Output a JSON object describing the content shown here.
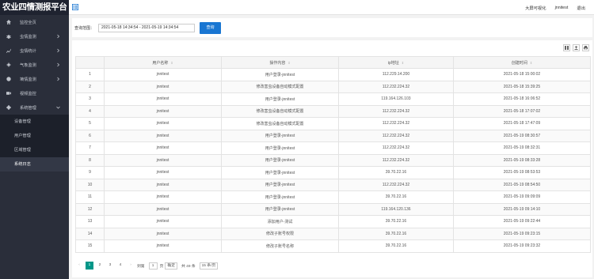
{
  "app": {
    "title": "农业四情测报平台"
  },
  "sidebar": {
    "items": [
      {
        "label": "监控全页",
        "icon": "home-icon",
        "expandable": false
      },
      {
        "label": "虫情监测",
        "icon": "bug-icon",
        "expandable": true
      },
      {
        "label": "虫情统计",
        "icon": "chart-line-icon",
        "expandable": true
      },
      {
        "label": "气象监测",
        "icon": "weather-icon",
        "expandable": true
      },
      {
        "label": "墒情监测",
        "icon": "globe-icon",
        "expandable": true
      },
      {
        "label": "视频监控",
        "icon": "video-icon",
        "expandable": false
      },
      {
        "label": "系统管理",
        "icon": "gear-icon",
        "expandable": true,
        "expanded": true
      }
    ],
    "sub_items": [
      {
        "label": "设备管理",
        "active": false
      },
      {
        "label": "用户管理",
        "active": false
      },
      {
        "label": "区域管理",
        "active": false
      },
      {
        "label": "系统日志",
        "active": true
      }
    ]
  },
  "topbar": {
    "links": [
      "大屏可视化",
      "jnnitest",
      "退出"
    ]
  },
  "search": {
    "label": "查询范围：",
    "value": "2021-05-18 14:34:54 - 2021-05-19 14:34:54",
    "button": "查询"
  },
  "table": {
    "headers": [
      "",
      "用户名称",
      "操作内容",
      "ip地址",
      "创建时间"
    ],
    "rows": [
      [
        "1",
        "jnnitest",
        "用户登录-jnnitest",
        "112.229.14.200",
        "2021-05-18 15:00:02"
      ],
      [
        "2",
        "jnnitest",
        "修改害虫设备自动模式配置",
        "112.232.224.32",
        "2021-05-18 15:39:25"
      ],
      [
        "3",
        "jnnitest",
        "用户登录-jnnitest",
        "119.164.126.103",
        "2021-05-18 16:06:52"
      ],
      [
        "4",
        "jnnitest",
        "修改害虫设备自动模式配置",
        "112.232.224.32",
        "2021-05-18 17:07:02"
      ],
      [
        "5",
        "jnnitest",
        "修改害虫设备自动模式配置",
        "112.232.224.32",
        "2021-05-18 17:47:09"
      ],
      [
        "6",
        "jnnitest",
        "用户登录-jnnitest",
        "112.232.224.32",
        "2021-05-19 08:30:57"
      ],
      [
        "7",
        "jnnitest",
        "用户登录-jnnitest",
        "112.232.224.32",
        "2021-05-19 08:32:31"
      ],
      [
        "8",
        "jnnitest",
        "用户登录-jnnitest",
        "112.232.224.32",
        "2021-05-19 08:33:28"
      ],
      [
        "9",
        "jnnitest",
        "用户登录-jnnitest",
        "39.70.22.16",
        "2021-05-19 08:53:53"
      ],
      [
        "10",
        "jnnitest",
        "用户登录-jnnitest",
        "112.232.224.32",
        "2021-05-19 08:54:50"
      ],
      [
        "11",
        "jnnitest",
        "用户登录-jnnitest",
        "39.70.22.16",
        "2021-05-19 09:09:09"
      ],
      [
        "12",
        "jnnitest",
        "用户登录-jnnitest",
        "119.164.120.136",
        "2021-05-19 09:14:10"
      ],
      [
        "13",
        "jnnitest",
        "添加用户-测试",
        "39.70.22.16",
        "2021-05-19 09:22:44"
      ],
      [
        "14",
        "jnnitest",
        "修改子账号权限",
        "39.70.22.16",
        "2021-05-19 09:23:15"
      ],
      [
        "15",
        "jnnitest",
        "修改子账号名称",
        "39.70.22.16",
        "2021-05-19 09:23:32"
      ]
    ]
  },
  "pager": {
    "prev": "‹",
    "pages": [
      "1",
      "2",
      "3",
      "4"
    ],
    "next": "›",
    "goto_label": "到第",
    "goto_value": "1",
    "goto_unit": "页",
    "goto_button": "确定",
    "total": "共 49 条",
    "per_page": "15 条/页"
  },
  "colors": {
    "sidebar": "#2a2e3a",
    "accent": "#1976d2",
    "pager_active": "#009688"
  }
}
